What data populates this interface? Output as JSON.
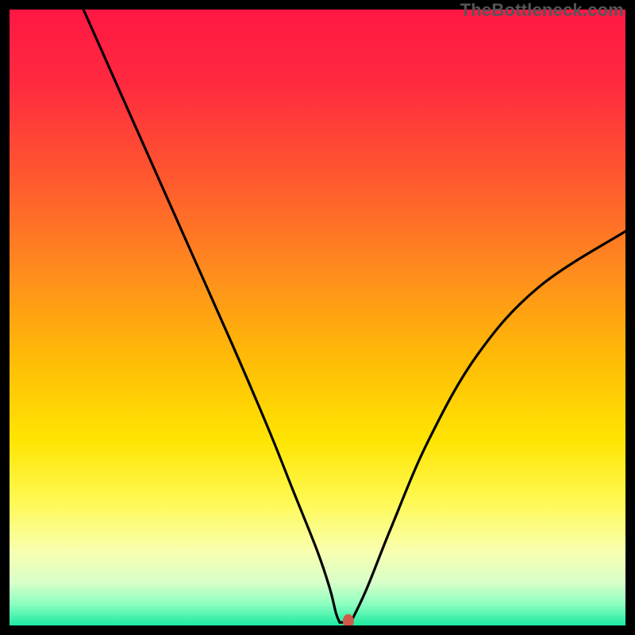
{
  "watermark": "TheBottleneck.com",
  "chart_data": {
    "type": "line",
    "title": "",
    "xlabel": "",
    "ylabel": "",
    "xlim": [
      0,
      100
    ],
    "ylim": [
      0,
      100
    ],
    "grid": false,
    "legend": false,
    "series": [
      {
        "name": "curve-left",
        "x": [
          12,
          20,
          28,
          36,
          42,
          46,
          50,
          52,
          53,
          53.6
        ],
        "y": [
          100,
          82,
          64,
          46,
          32,
          22,
          12,
          6,
          2,
          0.5
        ]
      },
      {
        "name": "curve-right",
        "x": [
          55.4,
          58,
          62,
          68,
          76,
          86,
          100
        ],
        "y": [
          0.5,
          6,
          16,
          30,
          44,
          55,
          64
        ]
      },
      {
        "name": "flat-bottom",
        "x": [
          53.6,
          55.4
        ],
        "y": [
          0.5,
          0.5
        ]
      }
    ],
    "marker": {
      "name": "optimal-point",
      "x": 55.0,
      "y": 0.7,
      "color": "#cf5a4a"
    },
    "background_gradient": {
      "stops": [
        {
          "offset": 0.0,
          "color": "#ff1744"
        },
        {
          "offset": 0.12,
          "color": "#ff2a3f"
        },
        {
          "offset": 0.28,
          "color": "#ff5a2e"
        },
        {
          "offset": 0.42,
          "color": "#ff8a1e"
        },
        {
          "offset": 0.56,
          "color": "#ffb907"
        },
        {
          "offset": 0.7,
          "color": "#ffe502"
        },
        {
          "offset": 0.8,
          "color": "#fff955"
        },
        {
          "offset": 0.88,
          "color": "#f8ffb0"
        },
        {
          "offset": 0.93,
          "color": "#d8ffc8"
        },
        {
          "offset": 0.965,
          "color": "#8dffc0"
        },
        {
          "offset": 1.0,
          "color": "#1de9a0"
        }
      ]
    }
  }
}
